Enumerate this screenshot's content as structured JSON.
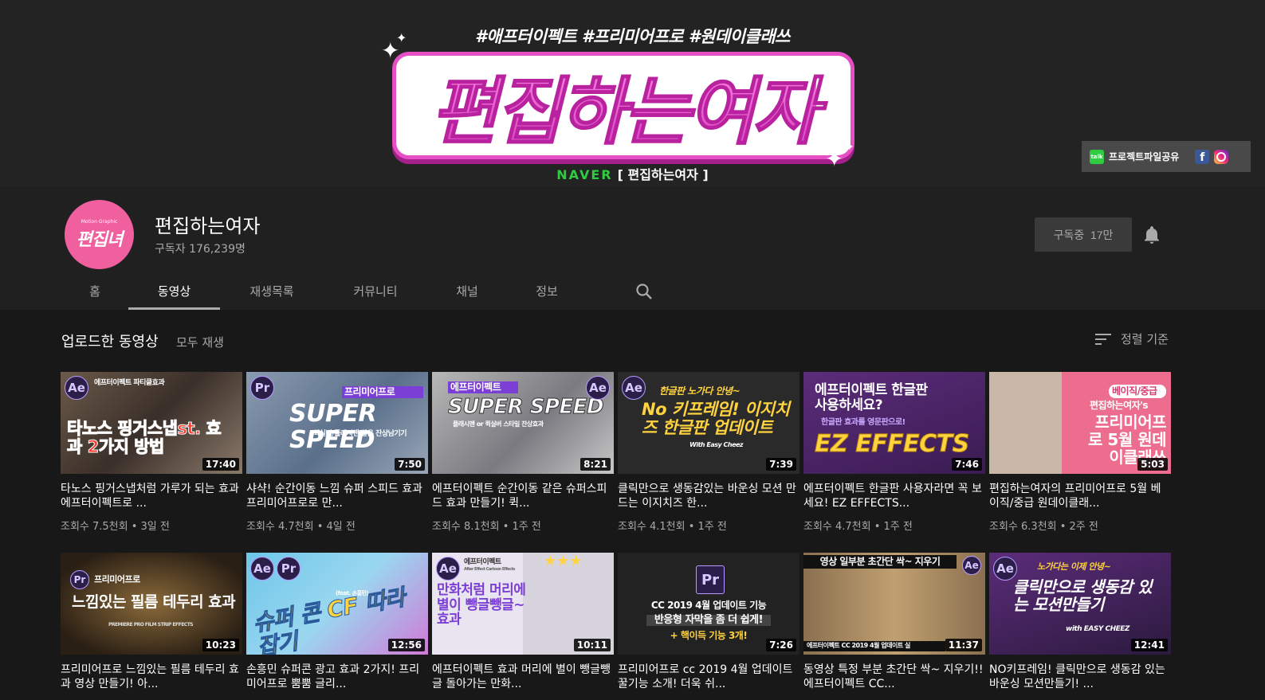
{
  "banner": {
    "tags": "#애프터이펙트 #프리미어프로 #원데이클래쓰",
    "title": "편집하는여자",
    "naver": "NAVER",
    "naver_bracket": "[ 편집하는여자 ]",
    "link_label": "프로젝트파일공유"
  },
  "channel": {
    "avatar_small": "Motion Graphic",
    "avatar_big": "편집녀",
    "name": "편집하는여자",
    "subscribers": "구독자 176,239명",
    "subscribe_label": "구독중",
    "subscribe_count": "17만"
  },
  "tabs": [
    "홈",
    "동영상",
    "재생목록",
    "커뮤니티",
    "채널",
    "정보"
  ],
  "active_tab": "동영상",
  "section": {
    "title": "업로드한 동영상",
    "play_all": "모두 재생",
    "sort_label": "정렬 기준"
  },
  "videos_row1": [
    {
      "thumb_text": "타노스 핑거스냅st. 효과 2가지 방법",
      "thumb_sub": "에프터이펙트 파티클효과",
      "badge": "Ae",
      "duration": "17:40",
      "title": "타노스 핑거스냅처럼 가루가 되는 효과 에프터이펙트로 ...",
      "meta": "조회수 7.5천회 • 3일 전"
    },
    {
      "thumb_text": "SUPER SPEED",
      "thumb_sub": "퀵실버/플래시맨 같은 잔상남기기",
      "thumb_tag": "프리미어프로",
      "badge": "Pr",
      "duration": "7:50",
      "title": "샤샥! 순간이동 느낌 슈퍼 스피드 효과 프리미어프로로 만...",
      "meta": "조회수 4.7천회 • 4일 전"
    },
    {
      "thumb_text": "SUPER SPEED",
      "thumb_sub": "플래시맨 or 퀵실버 스타일 잔상효과",
      "thumb_tag": "에프터이펙트",
      "badge": "Ae",
      "duration": "8:21",
      "title": "에프터이펙트 순간이동 같은 슈퍼스피드 효과 만들기! 퀵...",
      "meta": "조회수 8.1천회 • 1주 전"
    },
    {
      "thumb_text": "No 키프레임! 이지치즈 한글판 업데이트",
      "thumb_sub": "한글판 노가다 안녕~",
      "thumb_tag": "With Easy Cheez",
      "badge": "Ae",
      "duration": "7:39",
      "title": "클릭만으로 생동감있는 바운싱 모션 만드는 이지치즈 한...",
      "meta": "조회수 4.1천회 • 1주 전"
    },
    {
      "thumb_text": "EZ EFFECTS",
      "thumb_sub": "에프터이펙트 한글판 사용하세요?",
      "thumb_tag": "한글판 효과를 영문판으로!",
      "badge": "",
      "duration": "7:46",
      "title": "에프터이펙트 한글판 사용자라면 꼭 보세요! EZ EFFECTS...",
      "meta": "조회수 4.7천회 • 1주 전"
    },
    {
      "thumb_text": "프리미어프로 5월 원데이클래쓰",
      "thumb_sub": "편집하는여자's",
      "thumb_tag": "베이직/중급",
      "badge": "",
      "duration": "5:03",
      "title": "편집하는여자의 프리미어프로 5월 베이직/중급 원데이클래...",
      "meta": "조회수 6.3천회 • 2주 전"
    }
  ],
  "videos_row2": [
    {
      "thumb_text": "느낌있는 필름 테두리 효과",
      "thumb_sub": "프리미어프로",
      "thumb_tag": "PREMIERE PRO FILM STRIP EFFECTS",
      "badge": "Pr",
      "duration": "10:23",
      "title": "프리미어프로 느낌있는 필름 테두리 효과 영상 만들기! 아...",
      "meta": ""
    },
    {
      "thumb_text": "슈퍼 콘 CF 따라잡기",
      "thumb_sub": "(feat. 손흥민)",
      "badge": "Ae",
      "badge2": "Pr",
      "duration": "12:56",
      "title": "손흥민 슈퍼콘 광고 효과 2가지! 프리미어프로 뿜뿜 글리...",
      "meta": ""
    },
    {
      "thumb_text": "만화처럼 머리에 별이 뺑글뺑글~효과",
      "thumb_sub": "에프터이펙트",
      "thumb_tag": "After Effect Cartoon Effects",
      "badge": "Ae",
      "duration": "10:11",
      "title": "에프터이펙트 효과 머리에 별이 뺑글뺑글 돌아가는 만화...",
      "meta": ""
    },
    {
      "thumb_text": "CC 2019 4월 업데이트 기능",
      "thumb_sub": "반응형 자막을 좀 더 쉽게!",
      "thumb_tag": "+ 핵이득 기능 3개!",
      "badge": "Pr",
      "duration": "7:26",
      "title": "프리미어프로 cc 2019 4월 업데이트 꿀기능 소개! 더욱 쉬...",
      "meta": ""
    },
    {
      "thumb_text": "영상 일부분 초간단 싹~ 지우기",
      "thumb_sub": "에프터이펙트 CC 2019 4월 업데이트 실",
      "badge": "Ae",
      "duration": "11:37",
      "title": "동영상 특정 부분 초간단 싹~ 지우기!! 에프터이펙트 CC...",
      "meta": ""
    },
    {
      "thumb_text": "클릭만으로 생동감 있는 모션만들기",
      "thumb_sub": "노가다는 이제 안녕~",
      "thumb_tag": "with EASY CHEEZ",
      "badge": "Ae",
      "duration": "12:41",
      "title": "NO키프레임! 클릭만으로 생동감 있는 바운싱 모션만들기! ...",
      "meta": ""
    }
  ],
  "colors": {
    "accent_pink": "#f26ad9",
    "naver_green": "#2ecc40",
    "bg": "#181818"
  }
}
